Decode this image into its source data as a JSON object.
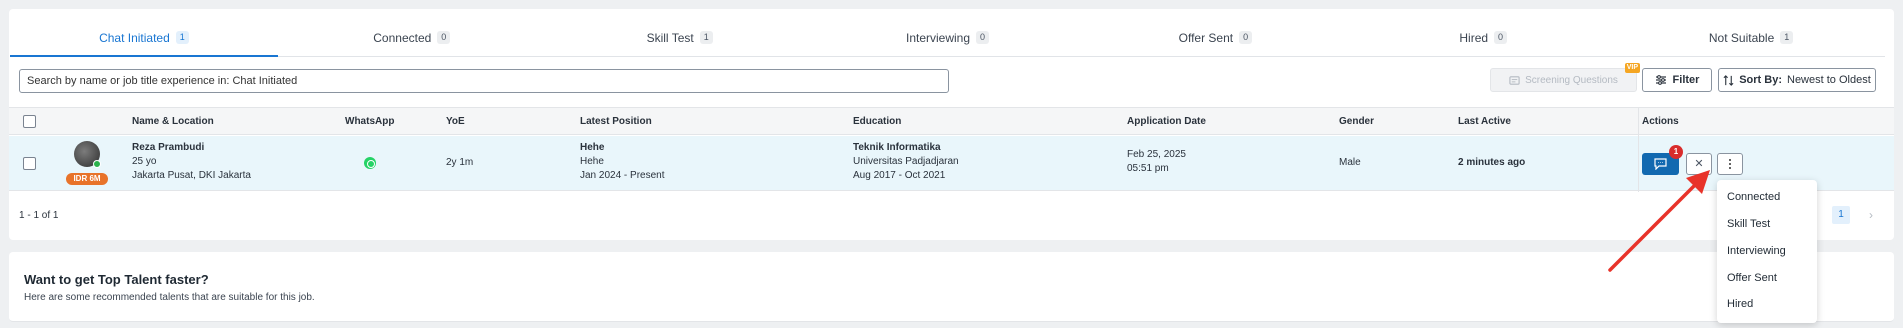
{
  "tabs": [
    {
      "label": "Chat Initiated",
      "count": "1"
    },
    {
      "label": "Connected",
      "count": "0"
    },
    {
      "label": "Skill Test",
      "count": "1"
    },
    {
      "label": "Interviewing",
      "count": "0"
    },
    {
      "label": "Offer Sent",
      "count": "0"
    },
    {
      "label": "Hired",
      "count": "0"
    },
    {
      "label": "Not Suitable",
      "count": "1"
    }
  ],
  "toolbar": {
    "search_value": "Search by name or job title experience in: Chat Initiated",
    "screening_label": "Screening Questions",
    "vip_label": "VIP",
    "filter_label": "Filter",
    "sort_prefix": "Sort By:",
    "sort_value": "Newest to Oldest"
  },
  "columns": {
    "name": "Name & Location",
    "whatsapp": "WhatsApp",
    "yoe": "YoE",
    "position": "Latest Position",
    "education": "Education",
    "date": "Application Date",
    "gender": "Gender",
    "active": "Last Active",
    "actions": "Actions"
  },
  "candidate": {
    "name": "Reza Prambudi",
    "age": "25 yo",
    "location": "Jakarta Pusat, DKI Jakarta",
    "salary": "IDR 6M",
    "yoe": "2y 1m",
    "position_title": "Hehe",
    "position_company": "Hehe",
    "position_period": "Jan 2024 - Present",
    "edu_major": "Teknik Informatika",
    "edu_school": "Universitas Padjadjaran",
    "edu_period": "Aug 2017 - Oct 2021",
    "app_date": "Feb 25, 2025",
    "app_time": "05:51 pm",
    "gender": "Male",
    "last_active": "2 minutes ago",
    "unread": "1"
  },
  "pagination": {
    "summary": "1 - 1 of 1",
    "current": "1"
  },
  "recommend": {
    "title": "Want to get Top Talent faster?",
    "subtitle": "Here are some recommended talents that are suitable for this job."
  },
  "menu": [
    "Connected",
    "Skill Test",
    "Interviewing",
    "Offer Sent",
    "Hired"
  ],
  "colors": {
    "accent": "#1976d2",
    "chat_button": "#1269b0",
    "salary_badge": "#e8732a",
    "arrow": "#e8332a"
  },
  "icons": [
    "whatsapp-icon",
    "chat-icon",
    "close-icon",
    "more-vertical-icon",
    "filter-icon",
    "sort-icon",
    "chevron-right-icon"
  ]
}
